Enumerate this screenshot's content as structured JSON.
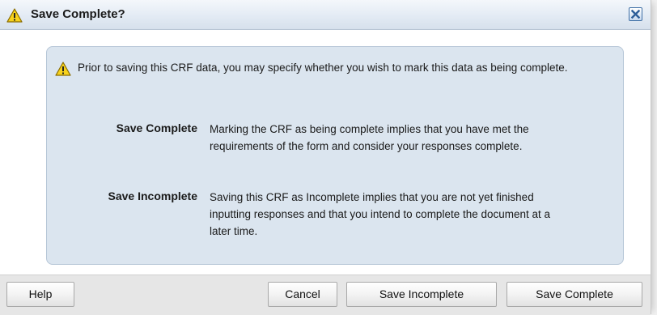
{
  "dialog": {
    "title": "Save Complete?",
    "title_icon": "warning-icon",
    "close_icon": "close-icon"
  },
  "content": {
    "intro_icon": "warning-icon",
    "intro": "Prior to saving this CRF data, you may specify whether you wish to mark this data as being complete.",
    "options": [
      {
        "term": "Save Complete",
        "description": "Marking the CRF as being complete implies that you have met the requirements of the form and consider your responses complete."
      },
      {
        "term": "Save Incomplete",
        "description": "Saving this CRF as Incomplete implies that you are not yet finished inputting responses and that you intend to complete the document at a later time."
      }
    ]
  },
  "footer": {
    "help_label": "Help",
    "cancel_label": "Cancel",
    "save_incomplete_label": "Save Incomplete",
    "save_complete_label": "Save Complete"
  },
  "colors": {
    "panel_background": "#dbe5ef",
    "panel_border": "#b6c6d7",
    "warning_yellow": "#f7d21c",
    "close_button_blue": "#2c5d99"
  }
}
